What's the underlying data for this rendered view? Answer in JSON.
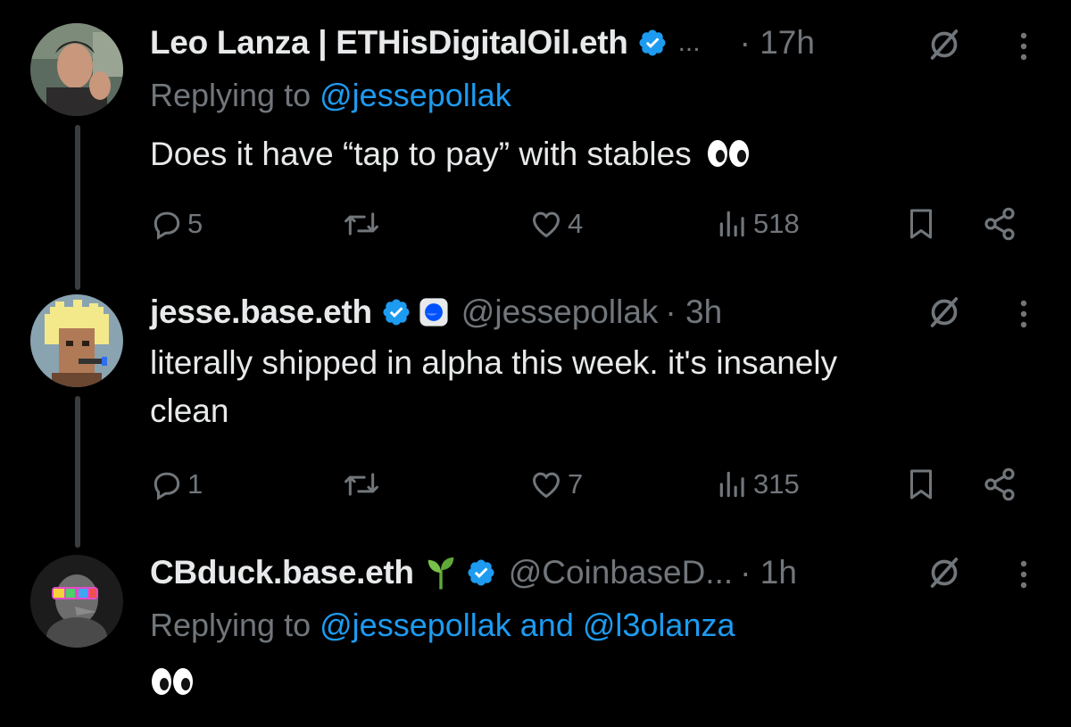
{
  "tweets": [
    {
      "name": "Leo Lanza | ETHisDigitalOil.eth",
      "ellipsis": "...",
      "handle": "",
      "time": "· 17h",
      "reply_prefix": "Replying to",
      "reply_mentions": "@jessepollak",
      "text": "Does it have “tap to pay” with stables",
      "emoji": "eyes",
      "replies": "5",
      "reposts": "",
      "likes": "4",
      "views": "518"
    },
    {
      "name": "jesse.base.eth",
      "handle": "@jessepollak",
      "time": "· 3h",
      "text_line1": "literally shipped in alpha this week. it's insanely",
      "text_line2": "clean",
      "replies": "1",
      "reposts": "",
      "likes": "7",
      "views": "315"
    },
    {
      "name": "CBduck.base.eth",
      "handle": "@CoinbaseD...",
      "time": "· 1h",
      "reply_prefix": "Replying to",
      "reply_mentions": "@jessepollak and @l3olanza",
      "emoji": "eyes"
    }
  ],
  "colors": {
    "background": "#000000",
    "primary_text": "#e7e9ea",
    "secondary_text": "#71767b",
    "accent": "#1d9bf0"
  }
}
